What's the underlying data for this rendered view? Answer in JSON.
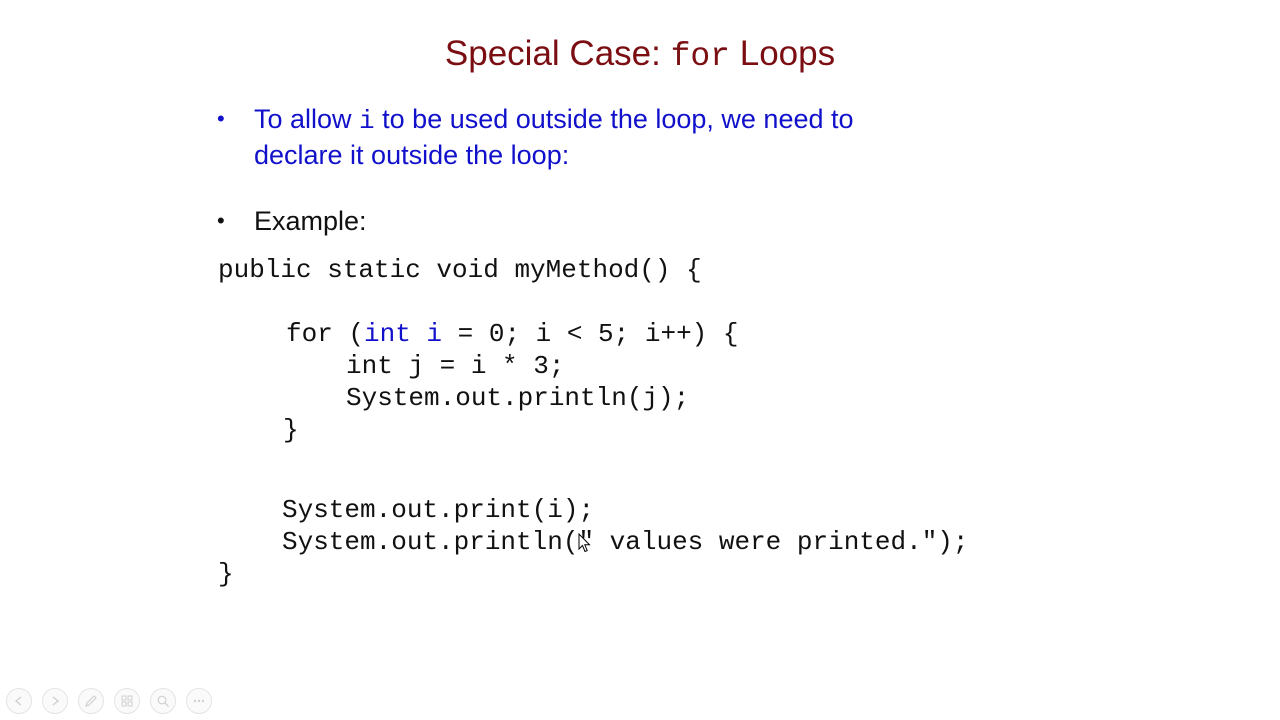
{
  "slide": {
    "title_prefix": "Special Case: ",
    "title_code": "for",
    "title_suffix": " Loops",
    "bullet1": {
      "part1": "To allow ",
      "code": "i",
      "part2": " to be used outside the loop, we need to",
      "line2": "declare it outside the loop:"
    },
    "bullet2": {
      "text": "Example:"
    },
    "bullet_symbol": "•",
    "code": {
      "line1": "public static void myMethod() {",
      "line2_pre": "for (",
      "line2_hl": "int i",
      "line2_post": " = 0; i < 5; i++) {",
      "line3": "int j = i * 3;",
      "line4": "System.out.println(j);",
      "line5": "}",
      "line6": "System.out.print(i);",
      "line7": "System.out.println(\" values were printed.\");",
      "line8": "}"
    }
  },
  "colors": {
    "title": "#7a0e12",
    "bullet_blue": "#1111cc",
    "text": "#111111"
  },
  "nav": {
    "icons": [
      "previous-icon",
      "next-icon",
      "pen-icon",
      "slides-grid-icon",
      "zoom-icon",
      "more-options-icon"
    ]
  }
}
